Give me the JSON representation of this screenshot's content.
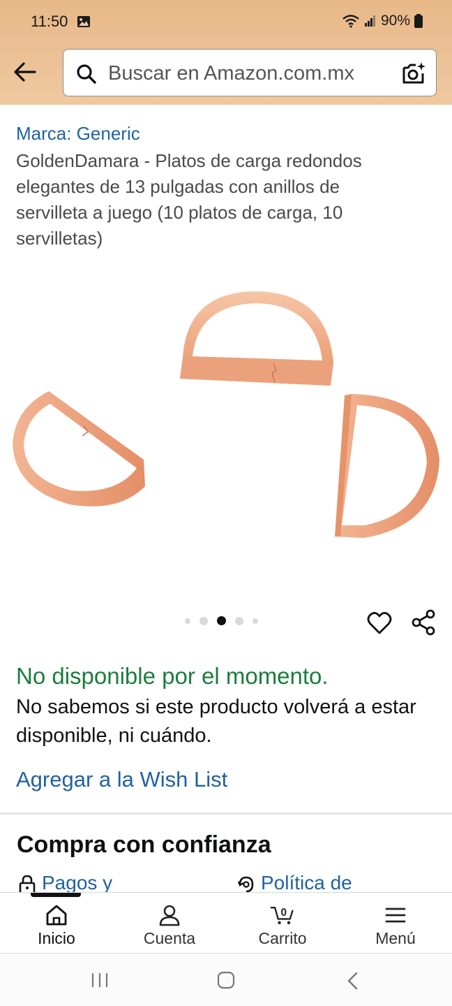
{
  "status_bar": {
    "time": "11:50",
    "battery": "90%"
  },
  "search": {
    "placeholder": "Buscar en Amazon.com.mx"
  },
  "product": {
    "brand_link": "Marca: Generic",
    "title": "GoldenDamara - Platos de carga redondos elegantes de 13 pulgadas con anillos de servilleta a juego (10 platos de carga, 10 servilletas)",
    "image_description_icon": "copper-napkin-rings",
    "carousel": {
      "count": 5,
      "active_index": 2
    }
  },
  "availability": {
    "status": "No disponible por el momento.",
    "note": "No sabemos si este producto volverá a estar disponible, ni cuándo.",
    "status_color": "#1c7d3c"
  },
  "wishlist": {
    "label": "Agregar a la Wish List"
  },
  "trust_section": {
    "heading": "Compra con confianza",
    "items": [
      {
        "label": "Pagos y",
        "icon": "lock-icon"
      },
      {
        "label": "Política de",
        "icon": "return-policy-icon"
      }
    ]
  },
  "tabs": [
    {
      "label": "Inicio",
      "icon": "home-icon",
      "active": true
    },
    {
      "label": "Cuenta",
      "icon": "account-icon",
      "active": false
    },
    {
      "label": "Carrito",
      "icon": "cart-icon",
      "active": false,
      "badge": "0"
    },
    {
      "label": "Menú",
      "icon": "menu-icon",
      "active": false
    }
  ],
  "colors": {
    "link": "#2162a1",
    "header_gradient_start": "#e8b887",
    "header_gradient_end": "#f0c9a0"
  }
}
